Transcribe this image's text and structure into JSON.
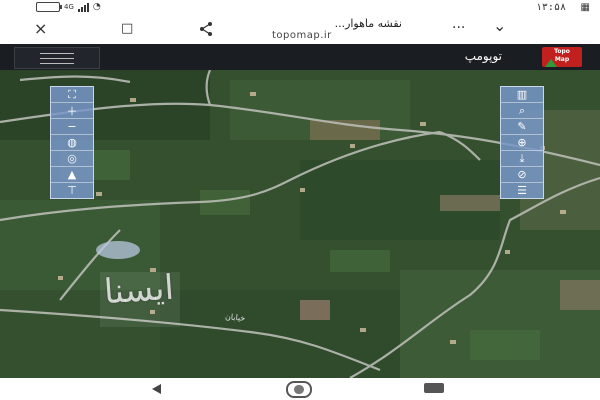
{
  "status": {
    "time": "۱۳:۵۸"
  },
  "browser": {
    "title": "نقشه ماهوار...",
    "url": "topomap.ir"
  },
  "app": {
    "name": "توپومپ",
    "logo_text": "Topo\nMap"
  },
  "map": {
    "watermark": "ایسنا",
    "street_label": "خیابان"
  },
  "icons": {
    "close": "×",
    "bookmark": "□",
    "share": "share-icon",
    "more": "···",
    "expand": "⌄"
  },
  "colors": {
    "header_bg": "#1a1d22",
    "toolbar_bg": "#7896c8",
    "logo_red": "#c21f1f"
  }
}
